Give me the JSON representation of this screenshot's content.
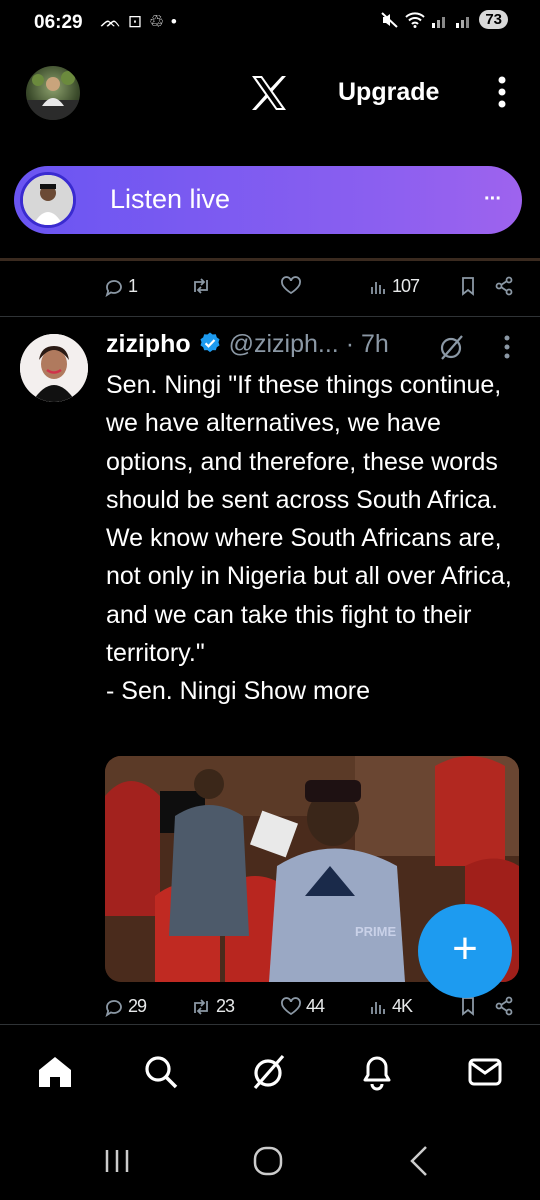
{
  "status_bar": {
    "time": "06:29",
    "left_icons": "ᨏ ⊡ ♲ •",
    "battery": "73"
  },
  "header": {
    "logo": "X",
    "upgrade_label": "Upgrade"
  },
  "listen_live": {
    "label": "Listen live"
  },
  "prev_tweet_actions": {
    "replies": "1",
    "reposts": "",
    "likes": "",
    "views": "107"
  },
  "tweet": {
    "display_name": "zizipho",
    "handle": "@ziziph...",
    "time": "7h",
    "text": "Sen. Ningi \"If these things continue, we have alternatives, we have options, and therefore, these words should be sent across South Africa. We know where South Africans are, not only in Nigeria but all over Africa, and we can take this fight to their territory.\"\n- Sen. Ningi",
    "show_more": "Show more",
    "media_watermark": "PRIME",
    "actions": {
      "replies": "29",
      "reposts": "23",
      "likes": "44",
      "views": "4K"
    }
  },
  "fab": {
    "label": "+"
  },
  "colors": {
    "accent": "#1d9bf0",
    "listen_gradient_start": "#6a55f2",
    "listen_gradient_end": "#9e63ee",
    "verified": "#1d9bf0"
  }
}
